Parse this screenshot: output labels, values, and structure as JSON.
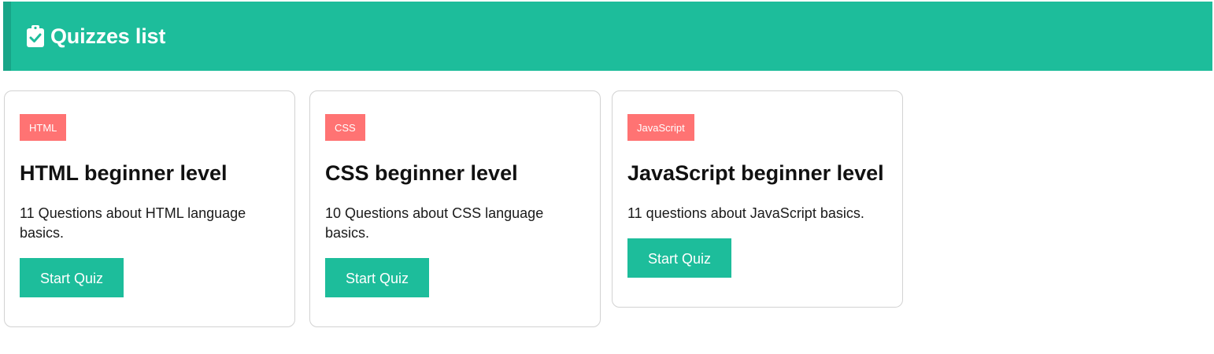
{
  "header": {
    "title": "Quizzes list",
    "icon": "clipboard-check-icon",
    "color": "#1dbd9b"
  },
  "quizzes": [
    {
      "badge": "HTML",
      "title": "HTML beginner level",
      "description": "11 Questions about HTML language basics.",
      "button_label": "Start Quiz"
    },
    {
      "badge": "CSS",
      "title": "CSS beginner level",
      "description": "10 Questions about CSS language basics.",
      "button_label": "Start Quiz"
    },
    {
      "badge": "JavaScript",
      "title": "JavaScript beginner level",
      "description": "11 questions about JavaScript basics.",
      "button_label": "Start Quiz"
    }
  ],
  "colors": {
    "accent": "#1dbd9b",
    "badge": "#ff7373"
  }
}
